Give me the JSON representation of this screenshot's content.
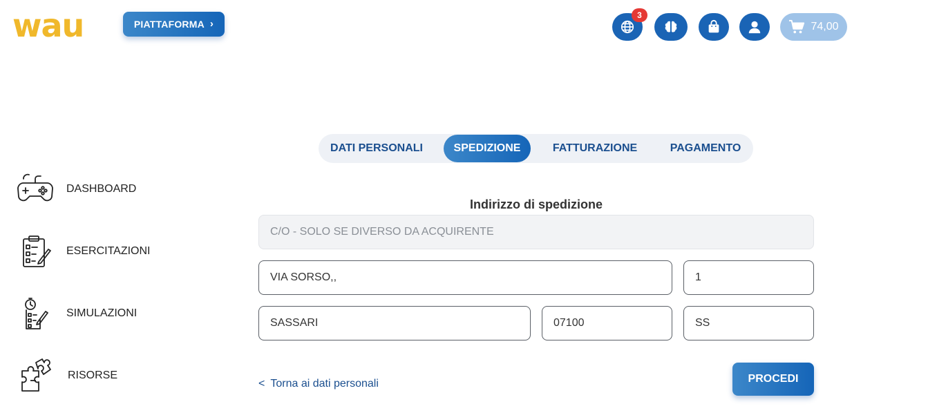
{
  "header": {
    "logo_text": "wau",
    "platform_button": "PIATTAFORMA",
    "notification_count": "3",
    "cart_total": "74,00",
    "icons": [
      "globe-icon",
      "brain-icon",
      "shopping-bag-icon",
      "user-icon",
      "cart-icon"
    ]
  },
  "steps": [
    {
      "label": "DATI PERSONALI",
      "active": false
    },
    {
      "label": "SPEDIZIONE",
      "active": true
    },
    {
      "label": "FATTURAZIONE",
      "active": false
    },
    {
      "label": "PAGAMENTO",
      "active": false
    }
  ],
  "sidebar": {
    "items": [
      {
        "label": "DASHBOARD",
        "icon": "gamepad-icon"
      },
      {
        "label": "ESERCITAZIONI",
        "icon": "clipboard-checklist-icon"
      },
      {
        "label": "SIMULAZIONI",
        "icon": "stopwatch-checklist-icon"
      },
      {
        "label": "RISORSE",
        "icon": "puzzle-icon"
      }
    ]
  },
  "form": {
    "title": "Indirizzo di spedizione",
    "care_of_placeholder": "C/O - SOLO SE DIVERSO DA ACQUIRENTE",
    "street": "VIA SORSO,,",
    "number": "1",
    "city": "SASSARI",
    "zip": "07100",
    "province": "SS",
    "back_link": "Torna ai dati personali",
    "back_chevron": "<",
    "submit": "PROCEDI"
  },
  "colors": {
    "brand_yellow": "#f0b82b",
    "primary_blue": "#1565b8",
    "badge_red": "#e53935"
  }
}
